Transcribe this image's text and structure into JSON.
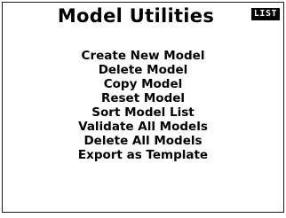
{
  "header": {
    "title": "Model Utilities",
    "badge": "LIST"
  },
  "menu": {
    "items": [
      {
        "label": "Create New Model"
      },
      {
        "label": "Delete Model"
      },
      {
        "label": "Copy Model"
      },
      {
        "label": "Reset Model"
      },
      {
        "label": "Sort Model List"
      },
      {
        "label": "Validate All Models"
      },
      {
        "label": "Delete All Models"
      },
      {
        "label": "Export as Template"
      }
    ]
  },
  "colors": {
    "background": "#ffffff",
    "foreground": "#000000"
  }
}
